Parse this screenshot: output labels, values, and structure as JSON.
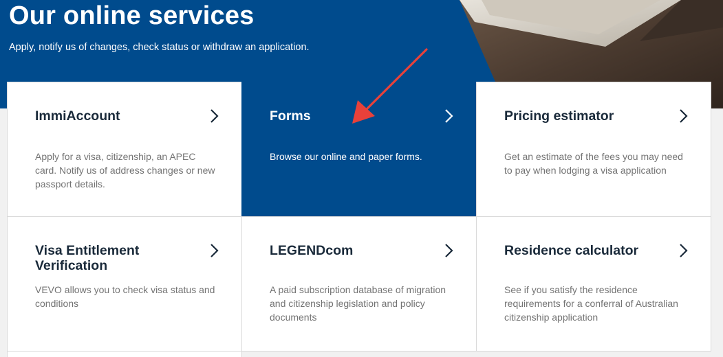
{
  "hero": {
    "title": "Our online services",
    "subtitle": "Apply, notify us of changes, check status or withdraw an application."
  },
  "cards": [
    {
      "title": "ImmiAccount",
      "desc": "Apply for a visa, citizenship, an APEC card. Notify us of address changes or new passport details.",
      "active": false
    },
    {
      "title": "Forms",
      "desc": "Browse our online and paper forms.",
      "active": true
    },
    {
      "title": "Pricing estimator",
      "desc": "Get an estimate of the fees you may need to pay when lodging a visa application",
      "active": false
    },
    {
      "title": "Visa Entitlement Verification",
      "desc": "VEVO allows you to check visa status and conditions",
      "active": false
    },
    {
      "title": "LEGENDcom",
      "desc": "A paid subscription database of migration and citizenship legislation and policy documents",
      "active": false
    },
    {
      "title": "Residence calculator",
      "desc": "See if you satisfy the residence requirements for a conferral of Australian citizenship application",
      "active": false
    }
  ],
  "colors": {
    "brand_blue": "#004b8d",
    "annotation_red": "#e8413a"
  },
  "icons": {
    "card_arrow": "chevron-right-icon"
  }
}
